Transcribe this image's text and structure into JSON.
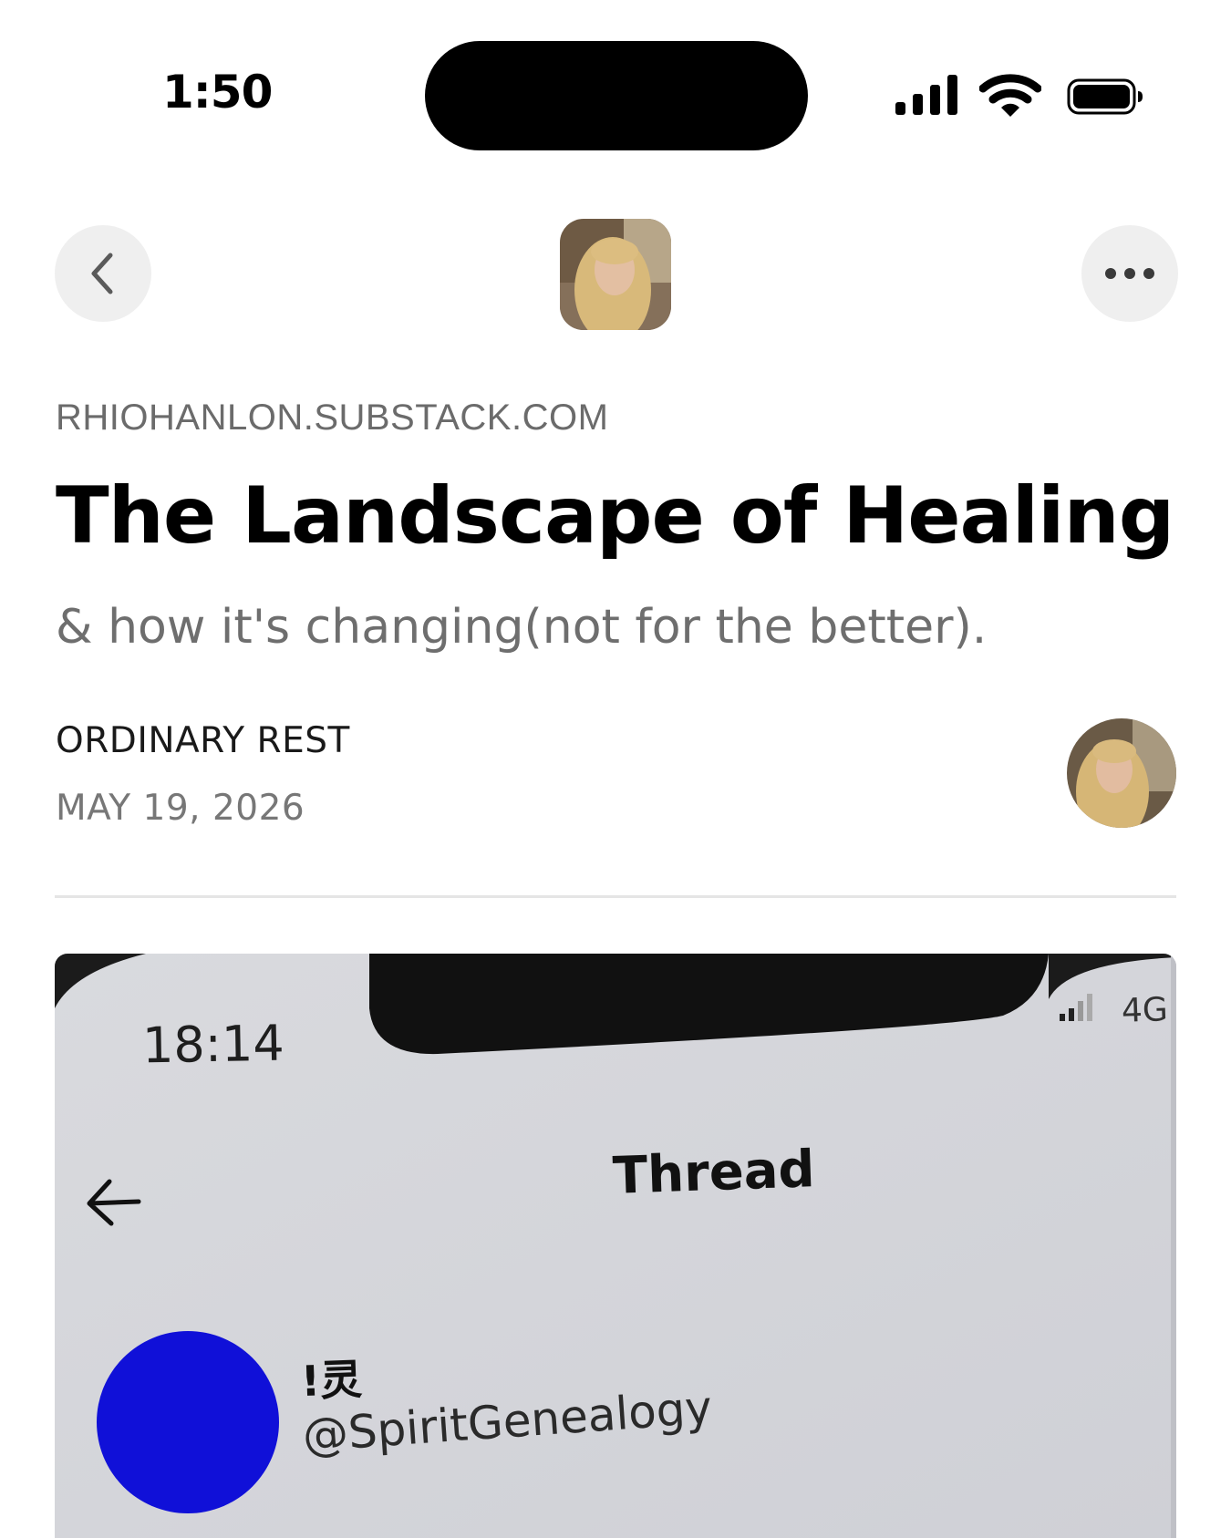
{
  "status_bar": {
    "time": "1:50",
    "icons": [
      "signal-icon",
      "wifi-icon",
      "battery-icon"
    ]
  },
  "nav": {
    "back_icon": "chevron-left-icon",
    "more_icon": "ellipsis-icon"
  },
  "article": {
    "publication_domain": "RHIOHANLON.SUBSTACK.COM",
    "title": "The Landscape of Healing",
    "subtitle": "& how it's changing(not for the better).",
    "author": "ORDINARY REST",
    "date": "MAY 19, 2026"
  },
  "embedded_image": {
    "status_time": "18:14",
    "network": "4G",
    "screen_title": "Thread",
    "user_name": "!灵",
    "user_handle": "@SpiritGenealogy",
    "avatar_color": "#1010d8"
  },
  "colors": {
    "button_bg": "#efefef",
    "meta_gray": "#6b6b6b",
    "divider": "#e5e5e5"
  }
}
